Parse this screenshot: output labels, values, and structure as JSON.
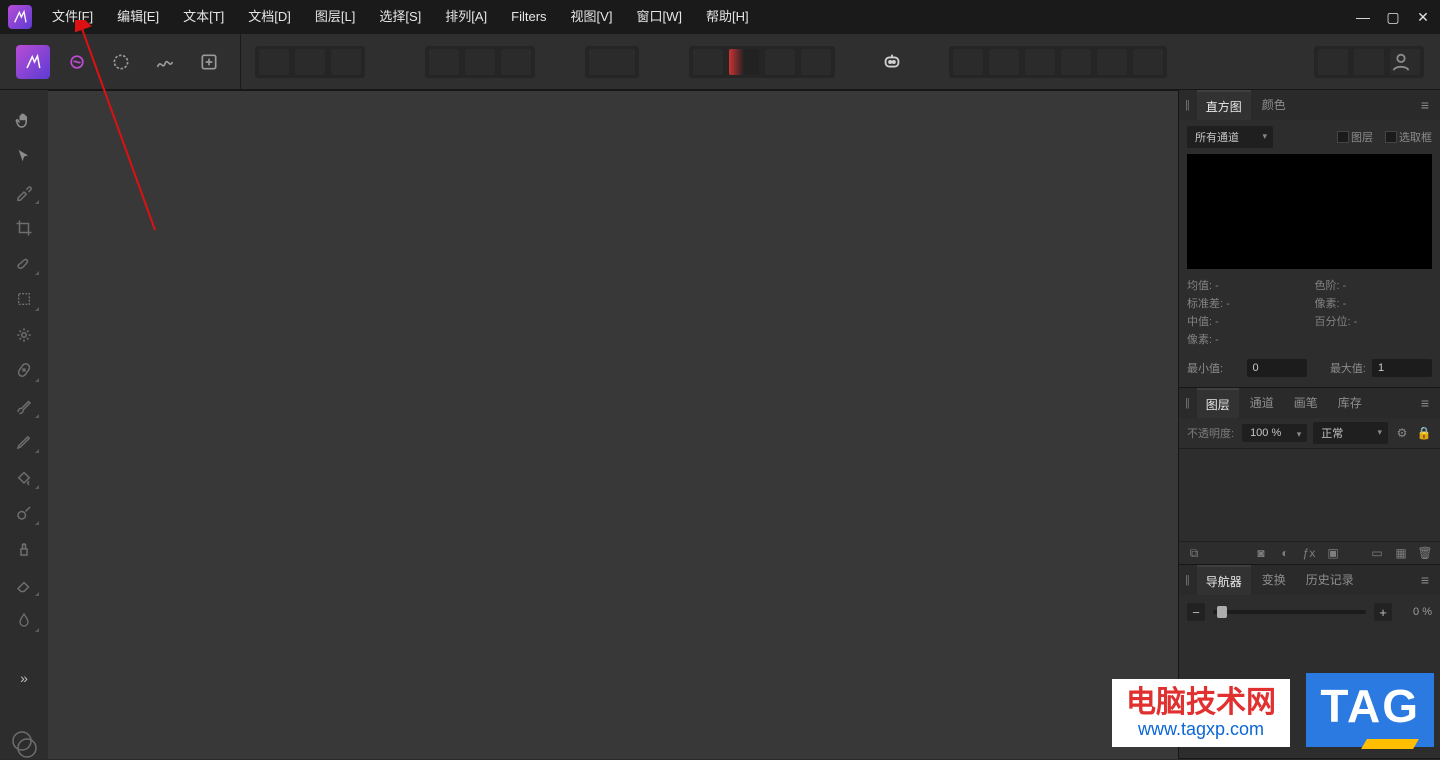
{
  "menu": {
    "items": [
      "文件[F]",
      "编辑[E]",
      "文本[T]",
      "文档[D]",
      "图层[L]",
      "选择[S]",
      "排列[A]",
      "Filters",
      "视图[V]",
      "窗口[W]",
      "帮助[H]"
    ]
  },
  "histogram_panel": {
    "tabs": [
      "直方图",
      "颜色"
    ],
    "active_tab": 0,
    "channel_label": "所有通道",
    "check_layer": "图层",
    "check_selection": "选取框",
    "stats": {
      "mean": "均值: -",
      "stddev": "标准差: -",
      "median": "中值: -",
      "pixels": "像素: -",
      "levels": "色阶: -",
      "px2": "像素: -",
      "percentile": "百分位: -"
    },
    "min_label": "最小值:",
    "min_value": "0",
    "max_label": "最大值:",
    "max_value": "1"
  },
  "layers_panel": {
    "tabs": [
      "图层",
      "通道",
      "画笔",
      "库存"
    ],
    "active_tab": 0,
    "opacity_label": "不透明度:",
    "opacity_value": "100 %",
    "blend_mode": "正常"
  },
  "navigator_panel": {
    "tabs": [
      "导航器",
      "变换",
      "历史记录"
    ],
    "active_tab": 0,
    "zoom_value": "0 %"
  },
  "watermark": {
    "text": "电脑技术网",
    "url": "www.tagxp.com",
    "tag": "TAG"
  }
}
